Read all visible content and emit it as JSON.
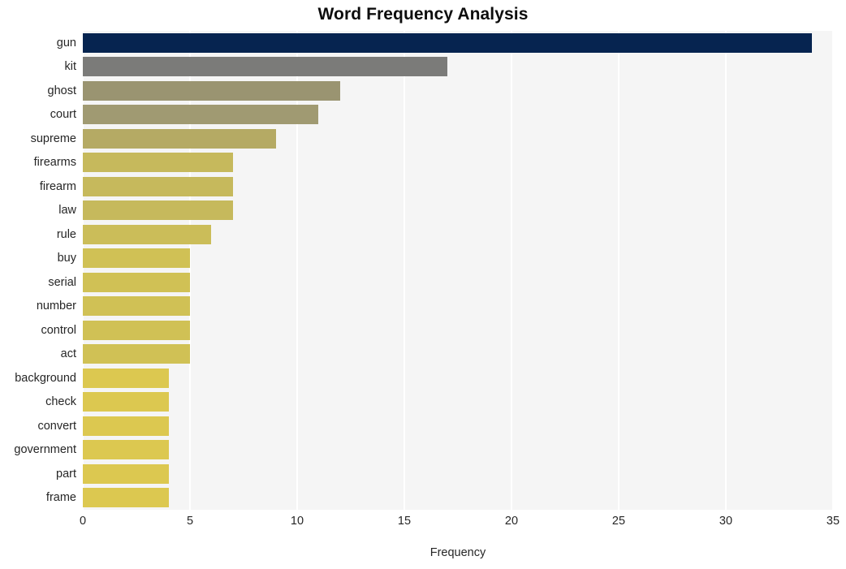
{
  "chart_data": {
    "type": "bar",
    "orientation": "horizontal",
    "title": "Word Frequency Analysis",
    "xlabel": "Frequency",
    "ylabel": "",
    "categories": [
      "gun",
      "kit",
      "ghost",
      "court",
      "supreme",
      "firearms",
      "firearm",
      "law",
      "rule",
      "buy",
      "serial",
      "number",
      "control",
      "act",
      "background",
      "check",
      "convert",
      "government",
      "part",
      "frame"
    ],
    "values": [
      34,
      17,
      12,
      11,
      9,
      7,
      7,
      7,
      6,
      5,
      5,
      5,
      5,
      5,
      4,
      4,
      4,
      4,
      4,
      4
    ],
    "xlim": [
      0,
      35
    ],
    "xticks": [
      0,
      5,
      10,
      15,
      20,
      25,
      30,
      35
    ],
    "xtick_labels": [
      "0",
      "5",
      "10",
      "15",
      "20",
      "25",
      "30",
      "35"
    ],
    "grid": true,
    "grid_axis": "x",
    "legend": "none",
    "bar_colors": [
      "#062450",
      "#7b7b79",
      "#9a9471",
      "#a09a72",
      "#b5aa64",
      "#c6b95c",
      "#c6b95c",
      "#c6b95c",
      "#cbbd59",
      "#d0c155",
      "#d0c155",
      "#d0c155",
      "#d0c155",
      "#d0c155",
      "#dcc850",
      "#dcc850",
      "#dcc850",
      "#dcc850",
      "#dcc850",
      "#dcc850"
    ],
    "plot_background": "#f5f5f5",
    "grid_color": "#ffffff",
    "figure_background": "#ffffff",
    "text_color": "#262626",
    "title_color": "#0d0d0d"
  }
}
